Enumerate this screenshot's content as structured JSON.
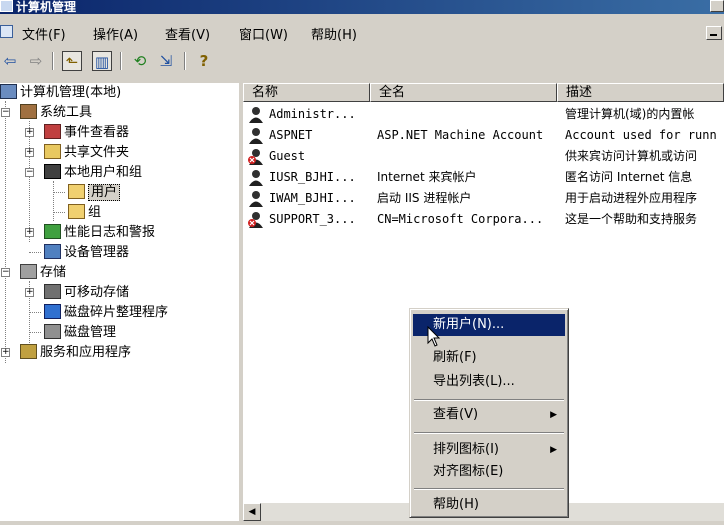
{
  "window": {
    "title": "计算机管理"
  },
  "menubar": {
    "items": [
      "文件(F)",
      "操作(A)",
      "查看(V)",
      "窗口(W)",
      "帮助(H)"
    ]
  },
  "toolbar": {
    "back": "⇦",
    "forward": "⇨",
    "up": "⬑",
    "show_tree": "▥",
    "refresh": "⟲",
    "export": "⇲",
    "help": "?"
  },
  "tree": {
    "root": "计算机管理(本地)",
    "system_tools": "系统工具",
    "event_viewer": "事件查看器",
    "shared_folders": "共享文件夹",
    "local_users_groups": "本地用户和组",
    "users": "用户",
    "groups": "组",
    "perf_logs": "性能日志和警报",
    "device_manager": "设备管理器",
    "storage": "存储",
    "removable_storage": "可移动存储",
    "defrag": "磁盘碎片整理程序",
    "disk_mgmt": "磁盘管理",
    "services_apps": "服务和应用程序"
  },
  "list": {
    "headers": [
      "名称",
      "全名",
      "描述"
    ],
    "rows": [
      {
        "name": "Administr...",
        "fullname": "",
        "desc": "管理计算机(域)的内置帐"
      },
      {
        "name": "ASPNET",
        "fullname": "ASP.NET Machine Account",
        "desc": "Account used for runn"
      },
      {
        "name": "Guest",
        "fullname": "",
        "desc": "供来宾访问计算机或访问"
      },
      {
        "name": "IUSR_BJHI...",
        "fullname": "Internet 来宾帐户",
        "desc": "匿名访问 Internet 信息"
      },
      {
        "name": "IWAM_BJHI...",
        "fullname": "启动 IIS 进程帐户",
        "desc": "用于启动进程外应用程序"
      },
      {
        "name": "SUPPORT_3...",
        "fullname": "CN=Microsoft Corpora...",
        "desc": "这是一个帮助和支持服务"
      }
    ]
  },
  "context_menu": {
    "new_user": "新用户(N)...",
    "refresh": "刷新(F)",
    "export_list": "导出列表(L)...",
    "view": "查看(V)",
    "arrange_icons": "排列图标(I)",
    "line_up_icons": "对齐图标(E)",
    "help": "帮助(H)"
  },
  "colors": {
    "title_bar": "#0a246a",
    "highlight": "#0a246a",
    "face": "#d4d0c8",
    "disabled_badge": "#d02020"
  }
}
